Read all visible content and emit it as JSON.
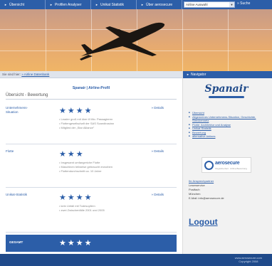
{
  "topnav": {
    "items": [
      {
        "label": "Übersicht"
      },
      {
        "label": "Profilen Analyser"
      },
      {
        "label": "Unikat Statistik"
      },
      {
        "label": "Über aerosecure"
      }
    ],
    "select_value": "Airline Auswahl",
    "search_label": "» Suche"
  },
  "breadcrumb": {
    "prefix": "Sie sind hier:",
    "link": "» Airline Datenbank"
  },
  "profile": {
    "header": "Spanair | Airline-Profil",
    "section_title": "Übersicht - Bewertung",
    "rows": [
      {
        "label": "Unternehmens-Situation",
        "stars": "★★★★",
        "notes": [
          "• Leader groß mit über 8 Mio. Passagieren",
          "• Flottengesellschaft der SAS Scandinavian",
          "• Mitglied der „Star Alliance”"
        ],
        "details": "» Details"
      },
      {
        "label": "Flotte",
        "stars": "★★★",
        "notes": [
          "• Insgesamt umfangreiche Flotte",
          "• Maschinen teilweise gebraucht erworben",
          "• Flottendurchschnitt ca. 10 Jahre"
        ],
        "details": "» Details"
      },
      {
        "label": "Unikat-Statistik",
        "stars": "★★★★",
        "notes": [
          "• kein Unfall mit Todesopfern",
          "• zwei Zwischenfälle 2001 und 2005"
        ],
        "details": "» Details"
      }
    ],
    "total": {
      "label": "GESAMT",
      "stars": "★★★★"
    }
  },
  "sidebar": {
    "heading": "Navigator",
    "logo_text": "Spanair",
    "links": [
      "Übersicht",
      "Allgemeines Unternehmens-Situation, Geschichte, Streckennetz",
      "Flotte: Architektur und Analyse",
      "Unikat-Statistik",
      "Bewertung",
      "alternative Airlines"
    ],
    "aero_name": "aerosecure",
    "aero_tag": "Flugsicherheit · Airline-Bewertung",
    "contact_title": "Ihr Ansprechpartner",
    "contact_lines": [
      "Leserservice",
      "Postfach",
      "München",
      "E-Mail: info@aerosecure.de"
    ],
    "logout": "Logout"
  },
  "footer": {
    "line1": "www.aerosecure.com",
    "line2": "Copyright 2008"
  },
  "colors": {
    "accent": "#2c5ea8",
    "footer": "#1f4a8a",
    "hero_sky": "#e6aa70"
  }
}
